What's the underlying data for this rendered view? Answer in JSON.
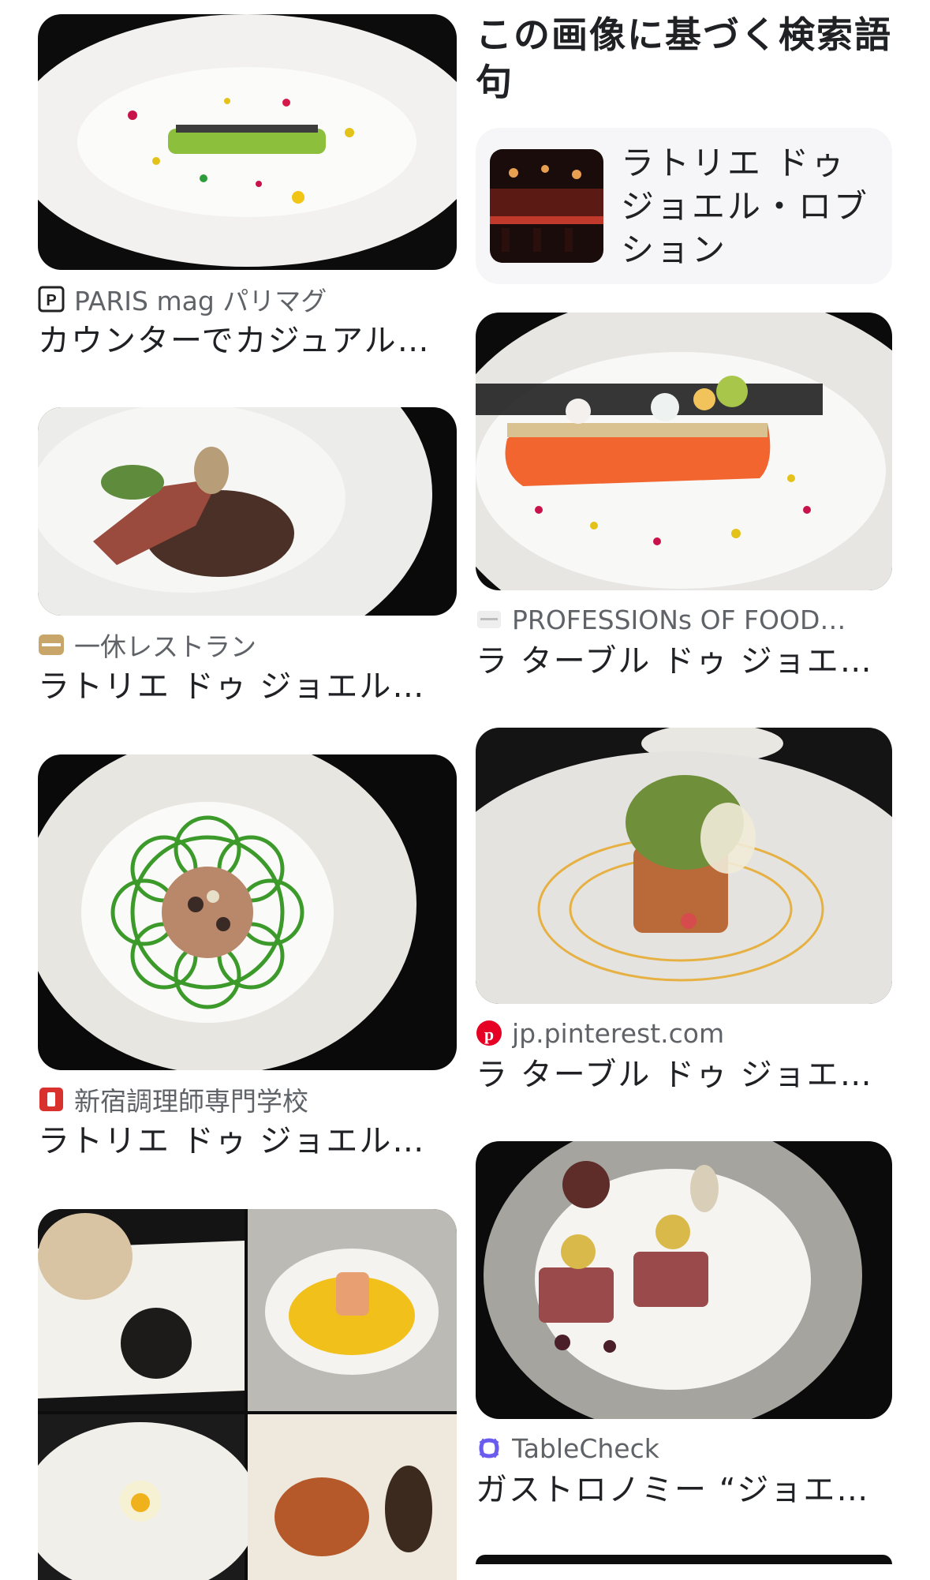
{
  "left_column": [
    {
      "source": "PARIS mag パリマグ",
      "title": "カウンターでカジュアル…",
      "icon": "paris-mag-logo-icon"
    },
    {
      "source": "一休レストラン",
      "title": "ラトリエ ドゥ ジョエル…",
      "icon": "ikyu-logo-icon"
    },
    {
      "source": "新宿調理師専門学校",
      "title": "ラトリエ ドゥ ジョエル…",
      "icon": "shinjuku-school-logo-icon"
    }
  ],
  "related_searches": {
    "heading": "この画像に基づく検索語句",
    "item_label": "ラトリエ ドゥ ジョエル・ロブション"
  },
  "right_column": [
    {
      "source": "PROFESSIONs OF FOOD…",
      "title": "ラ ターブル ドゥ ジョエ…",
      "icon": "professions-logo-icon"
    },
    {
      "source": "jp.pinterest.com",
      "title": "ラ ターブル ドゥ ジョエ…",
      "icon": "pinterest-logo-icon"
    },
    {
      "source": "TableCheck",
      "title": "ガストロノミー “ジョエ…",
      "icon": "tablecheck-logo-icon"
    }
  ],
  "colors": {
    "pinterest": "#e60023",
    "tablecheck": "#6b5cf0",
    "ikyu": "#c8a66a",
    "school": "#d9322e"
  }
}
